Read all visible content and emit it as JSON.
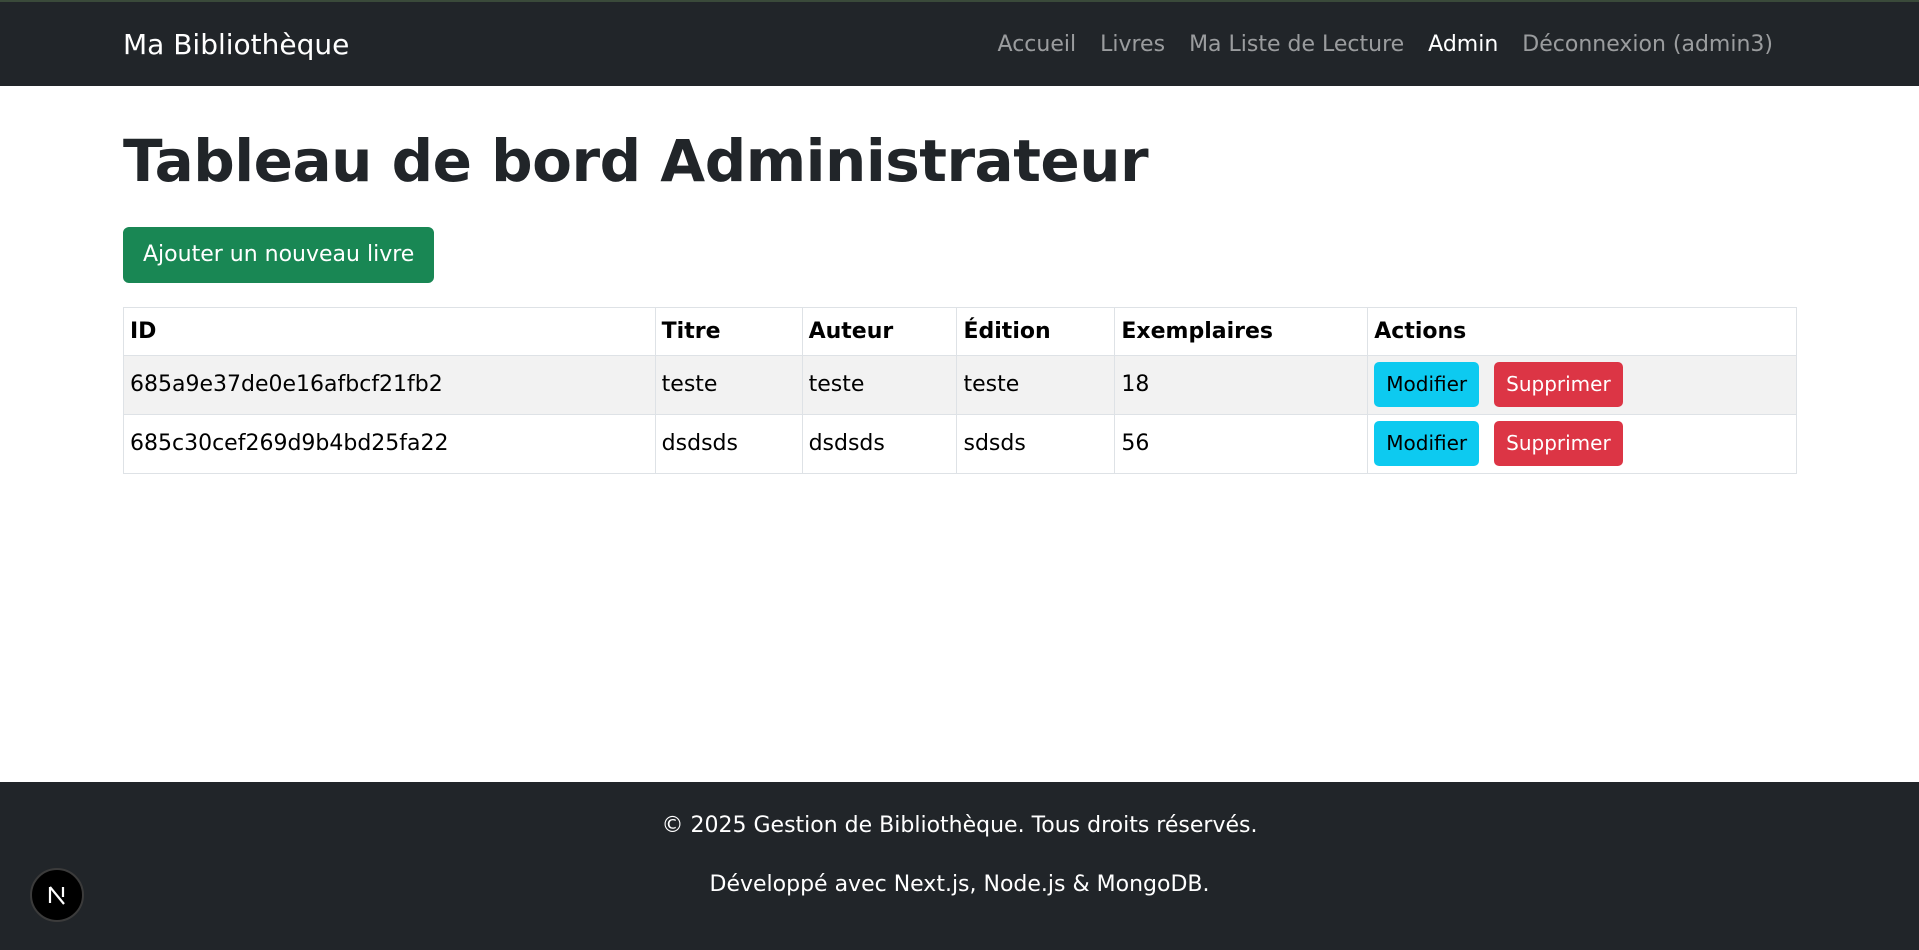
{
  "navbar": {
    "brand": "Ma Bibliothèque",
    "links": [
      {
        "label": "Accueil",
        "active": false
      },
      {
        "label": "Livres",
        "active": false
      },
      {
        "label": "Ma Liste de Lecture",
        "active": false
      },
      {
        "label": "Admin",
        "active": true
      },
      {
        "label": "Déconnexion (admin3)",
        "active": false
      }
    ]
  },
  "main": {
    "title": "Tableau de bord Administrateur",
    "add_button_label": "Ajouter un nouveau livre",
    "table": {
      "headers": [
        "ID",
        "Titre",
        "Auteur",
        "Édition",
        "Exemplaires",
        "Actions"
      ],
      "rows": [
        {
          "id": "685a9e37de0e16afbcf21fb2",
          "titre": "teste",
          "auteur": "teste",
          "edition": "teste",
          "exemplaires": "18"
        },
        {
          "id": "685c30cef269d9b4bd25fa22",
          "titre": "dsdsds",
          "auteur": "dsdsds",
          "edition": "sdsds",
          "exemplaires": "56"
        }
      ],
      "edit_label": "Modifier",
      "delete_label": "Supprimer"
    }
  },
  "footer": {
    "copyright": "© 2025 Gestion de Bibliothèque. Tous droits réservés.",
    "tech": "Développé avec Next.js, Node.js & MongoDB."
  },
  "colors": {
    "navbar_bg": "#212529",
    "success": "#198754",
    "info": "#0dcaf0",
    "danger": "#dc3545"
  },
  "icons": {
    "next_badge": "nextjs-logo-icon"
  }
}
